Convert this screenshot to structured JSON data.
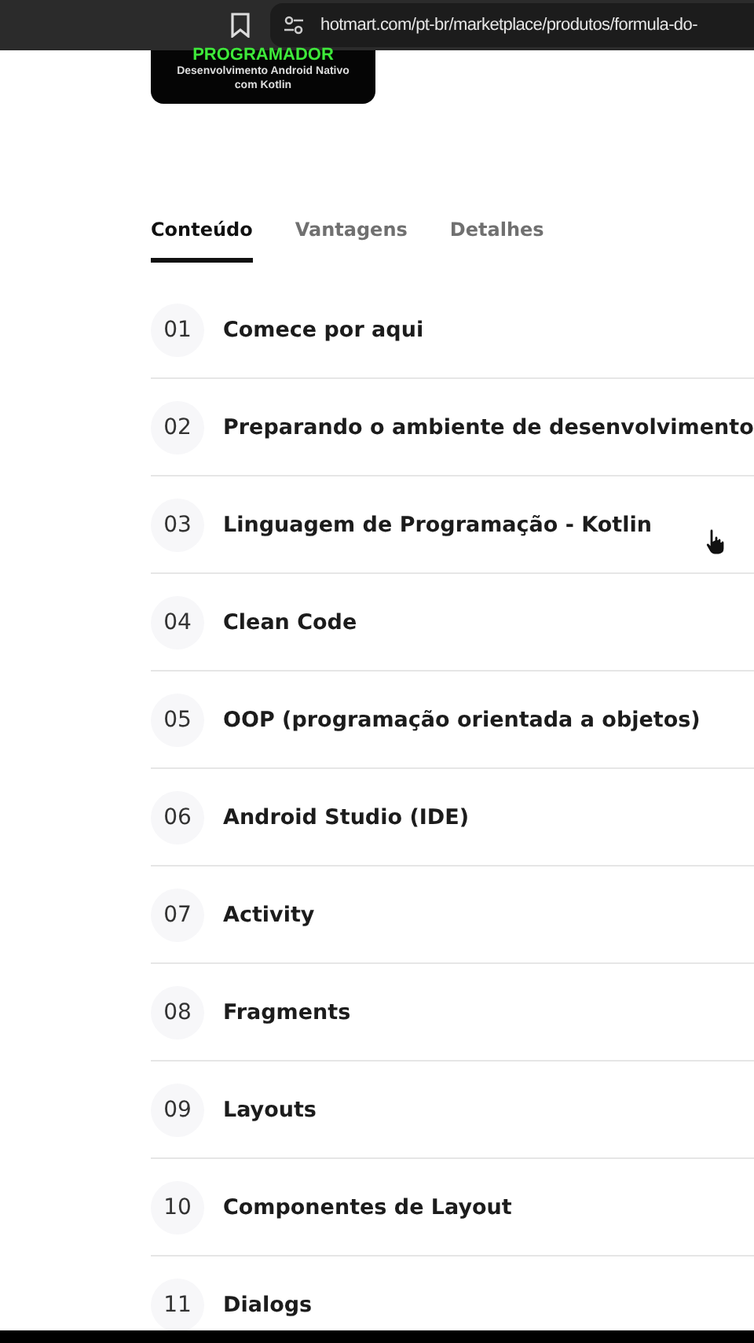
{
  "browser": {
    "url": "hotmart.com/pt-br/marketplace/produtos/formula-do-"
  },
  "product_image": {
    "title": "PROGRAMADOR",
    "subtitle": "Desenvolvimento Android Nativo",
    "subtitle_2": "com Kotlin"
  },
  "tabs": [
    {
      "label": "Conteúdo",
      "selected": true
    },
    {
      "label": "Vantagens",
      "selected": false
    },
    {
      "label": "Detalhes",
      "selected": false
    }
  ],
  "modules": [
    {
      "number": "01",
      "title": "Comece por aqui"
    },
    {
      "number": "02",
      "title": "Preparando o ambiente de desenvolvimento"
    },
    {
      "number": "03",
      "title": "Linguagem de Programação - Kotlin"
    },
    {
      "number": "04",
      "title": "Clean Code"
    },
    {
      "number": "05",
      "title": "OOP (programação orientada a objetos)"
    },
    {
      "number": "06",
      "title": "Android Studio (IDE)"
    },
    {
      "number": "07",
      "title": "Activity"
    },
    {
      "number": "08",
      "title": "Fragments"
    },
    {
      "number": "09",
      "title": "Layouts"
    },
    {
      "number": "10",
      "title": "Componentes de Layout"
    },
    {
      "number": "11",
      "title": "Dialogs"
    }
  ]
}
